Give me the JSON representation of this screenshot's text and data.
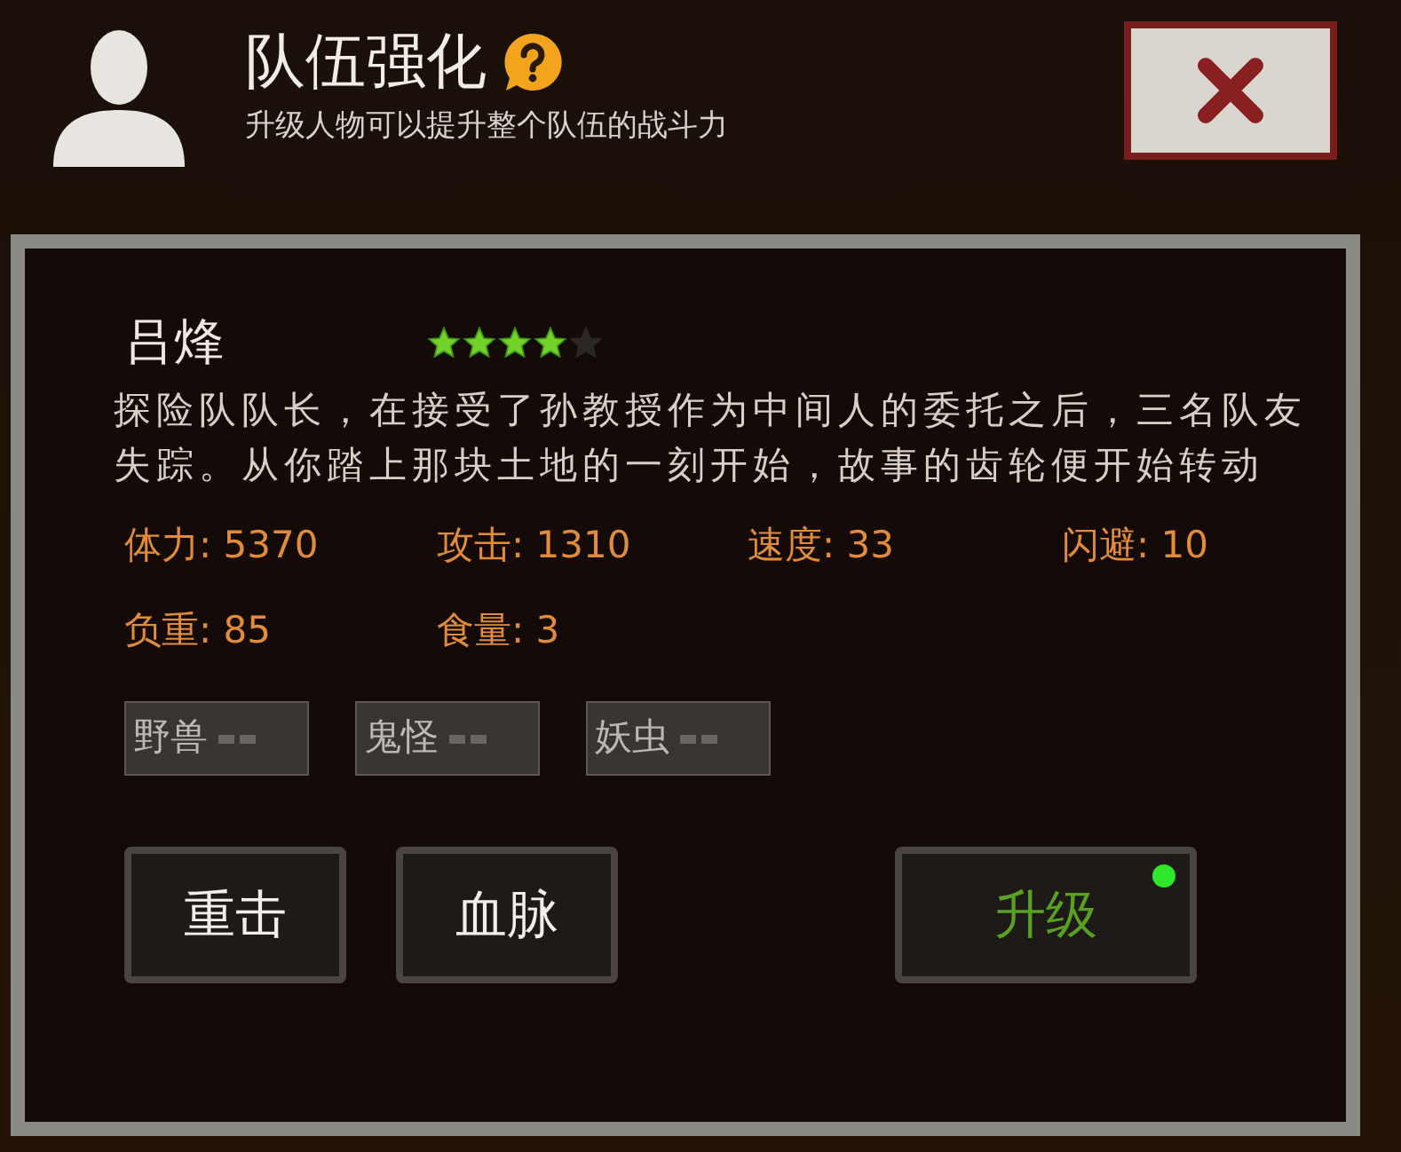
{
  "header": {
    "title": "队伍强化",
    "subtitle": "升级人物可以提升整个队伍的战斗力"
  },
  "hero": {
    "name": "吕烽",
    "stars": 4,
    "description": "探险队队长，在接受了孙教授作为中间人的委托之后，三名队友失踪。从你踏上那块土地的一刻开始，故事的齿轮便开始转动",
    "stats": [
      {
        "label": "体力: 5370"
      },
      {
        "label": "攻击: 1310"
      },
      {
        "label": "速度: 33"
      },
      {
        "label": "闪避: 10"
      },
      {
        "label": "负重: 85"
      },
      {
        "label": "食量: 3"
      }
    ],
    "tags": [
      {
        "label": "野兽"
      },
      {
        "label": "鬼怪"
      },
      {
        "label": "妖虫"
      }
    ]
  },
  "buttons": [
    {
      "label": "重击",
      "highlighted": false,
      "badge": false
    },
    {
      "label": "血脉",
      "highlighted": false,
      "badge": false
    },
    {
      "label": "升级",
      "highlighted": true,
      "badge": true
    }
  ]
}
